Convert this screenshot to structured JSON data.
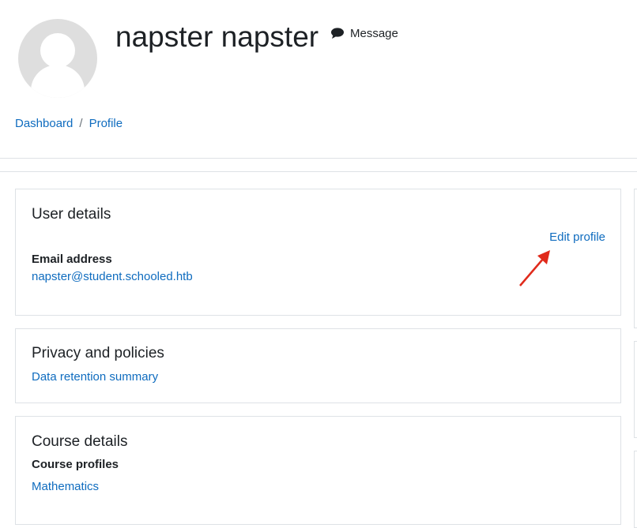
{
  "profile": {
    "name": "napster napster",
    "message_label": "Message"
  },
  "breadcrumb": {
    "items": [
      "Dashboard",
      "Profile"
    ],
    "separator": "/"
  },
  "user_details": {
    "heading": "User details",
    "edit_label": "Edit profile",
    "email_label": "Email address",
    "email_value": "napster@student.schooled.htb"
  },
  "privacy": {
    "heading": "Privacy and policies",
    "link": "Data retention summary"
  },
  "course_details": {
    "heading": "Course details",
    "profiles_label": "Course profiles",
    "courses": [
      "Mathematics"
    ]
  },
  "colors": {
    "link": "#0f6cbf",
    "annotation_arrow": "#e02a1b",
    "avatar": "#dedede"
  },
  "icons": {
    "message": "comment-icon",
    "annotation": "red-arrow-icon"
  }
}
